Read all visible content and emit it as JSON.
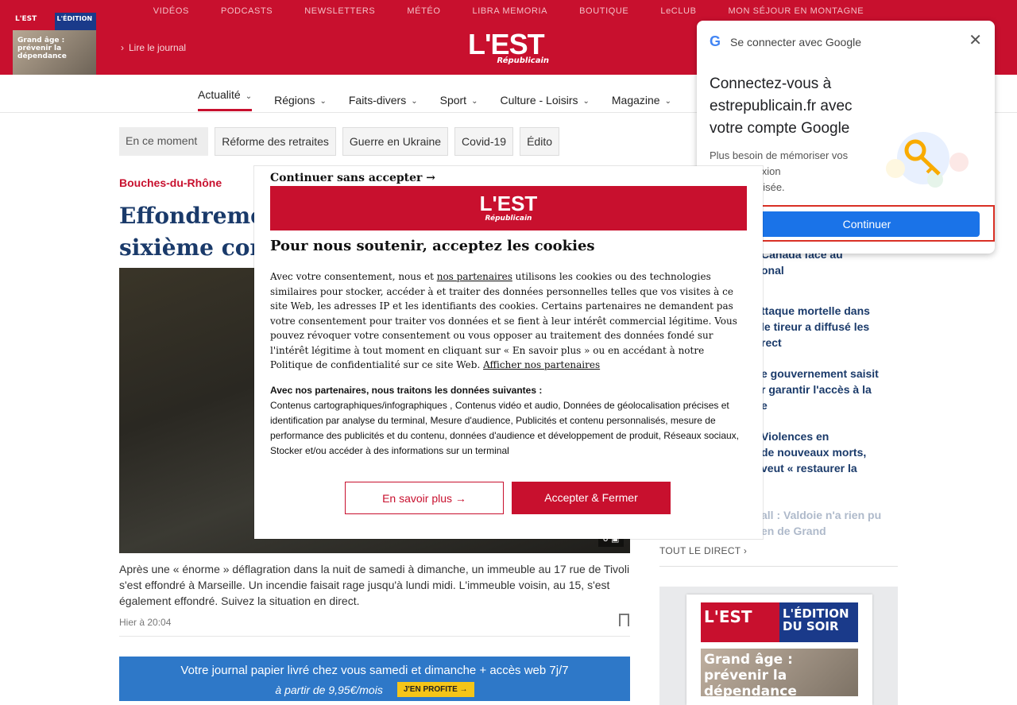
{
  "topnav": [
    "VIDÉOS",
    "PODCASTS",
    "NEWSLETTERS",
    "MÉTÉO",
    "LIBRA MEMORIA",
    "BOUTIQUE",
    "LeCLUB",
    "MON SÉJOUR EN MONTAGNE"
  ],
  "header": {
    "journal_thumb": {
      "left": "L'EST",
      "right": "L'ÉDITION",
      "title": "Grand âge : prévenir la dépendance"
    },
    "read_journal": "Lire le journal",
    "logo_main": "L'EST",
    "logo_sub": "Républicain"
  },
  "mainnav": [
    "Actualité",
    "Régions",
    "Faits-divers",
    "Sport",
    "Culture - Loisirs",
    "Magazine"
  ],
  "tags": {
    "moment": "En ce moment",
    "items": [
      "Réforme des retraites",
      "Guerre en Ukraine",
      "Covid-19",
      "Édito"
    ]
  },
  "article": {
    "category": "Bouches-du-Rhône",
    "headline_l1": "Effondrement",
    "headline_l2": "sixième corps",
    "caption": "Après une « énorme » déflagration dans la nuit de samedi à dimanche, un immeuble au 17 rue de Tivoli s'est effondré à Marseille. Un incendie faisait rage jusqu'à lundi midi. L'immeuble voisin, au 15, s'est également effondré. Suivez la situation en direct.",
    "date": "Hier à 20:04",
    "gallery_count": "6"
  },
  "promo": {
    "line1": "Votre journal papier livré chez vous samedi et dimanche + accès web 7j/7",
    "line2": "à partir de 9,95€/mois",
    "cta": "J'EN PROFITE →"
  },
  "stream": {
    "items": [
      {
        "live": "",
        "text": "Canada face au\nonal"
      },
      {
        "live": "",
        "text": "ttaque mortelle dans\nle tireur a diffusé les\nrect"
      },
      {
        "live": "",
        "text": "e gouvernement saisit\nr garantir l'accès à la\ne"
      },
      {
        "live": "nt ",
        "text": "Violences en\nde nouveaux morts,\nveut « restaurer la"
      },
      {
        "live": "",
        "text": "all : Valdoie n'a rien pu\nen de Grand"
      }
    ],
    "all_link": "TOUT LE DIRECT",
    "kiosk": {
      "left": "L'EST",
      "right": "L'ÉDITION DU SOIR",
      "title": "Grand âge : prévenir la dépendance"
    }
  },
  "google": {
    "header": "Se connecter avec Google",
    "title": "Connectez-vous à estrepublicain.fr avec votre compte Google",
    "subtitle": "Plus besoin de mémoriser vos\nsse. Connexion\nide et sécurisée.",
    "button": "Continuer"
  },
  "cookie": {
    "skip": "Continuer sans accepter →",
    "logo_main": "L'EST",
    "logo_sub": "Républicain",
    "title": "Pour nous soutenir, acceptez les cookies",
    "body_pre": "Avec votre consentement, nous et ",
    "partners_link": "nos partenaires",
    "body_main": " utilisons les cookies ou des technologies similaires pour stocker, accéder à et traiter des données personnelles telles que vos visites à ce site Web, les adresses IP et les identifiants des cookies. Certains partenaires ne demandent pas votre consentement pour traiter vos données et se fient à leur intérêt commercial légitime. Vous pouvez révoquer votre consentement ou vous opposer au traitement des données fondé sur l'intérêt légitime à tout moment en cliquant sur « En savoir plus » ou en accédant à notre Politique de confidentialité sur ce site Web. ",
    "show_partners": "Afficher nos partenaires",
    "purposes_title": "Avec nos partenaires, nous traitons les données suivantes :",
    "purposes": "Contenus cartographiques/infographiques , Contenus vidéo et audio, Données de géolocalisation précises et identification par analyse du terminal, Mesure d'audience, Publicités et contenu personnalisés, mesure de performance des publicités et du contenu, données d'audience et développement de produit, Réseaux sociaux, Stocker et/ou accéder à des informations sur un terminal",
    "more_button": "En savoir plus →",
    "accept_button": "Accepter & Fermer"
  }
}
